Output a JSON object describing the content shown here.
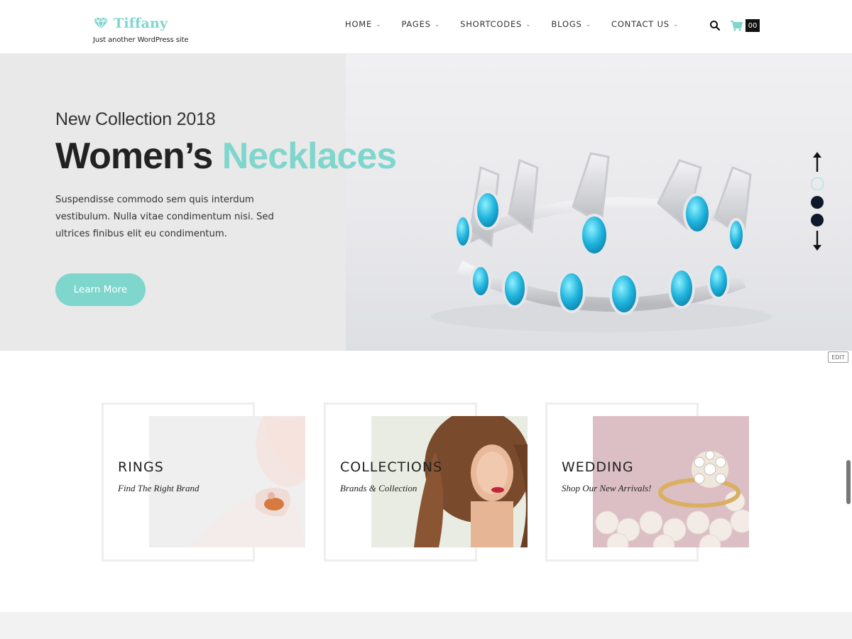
{
  "header": {
    "logo_text": "Tiffany",
    "tagline": "Just another WordPress site",
    "nav": [
      {
        "label": "HOME"
      },
      {
        "label": "PAGES"
      },
      {
        "label": "SHORTCODES"
      },
      {
        "label": "BLOGS"
      },
      {
        "label": "CONTACT US"
      }
    ],
    "search_icon": "search-icon",
    "cart_icon": "shopping-cart-icon",
    "cart_count": "00"
  },
  "hero": {
    "subtitle": "New Collection 2018",
    "title_part1": "Women’s",
    "title_part2": "Necklaces",
    "description": "Suspendisse commodo sem quis interdum vestibulum. Nulla vitae condimentum nisi. Sed ultrices finibus elit eu condimentum.",
    "button_label": "Learn More",
    "slider_dots": 3,
    "active_dot": 1
  },
  "edit_label": "EDIT",
  "categories": [
    {
      "title": "RINGS",
      "subtitle": "Find The Right Brand"
    },
    {
      "title": "COLLECTIONS",
      "subtitle": "Brands & Collection"
    },
    {
      "title": "WEDDING",
      "subtitle": "Shop Our New Arrivals!"
    }
  ],
  "colors": {
    "accent": "#7fd6cd",
    "dark": "#222222",
    "hero_bg": "#e9e9ea",
    "dot": "#0d1a2b"
  }
}
